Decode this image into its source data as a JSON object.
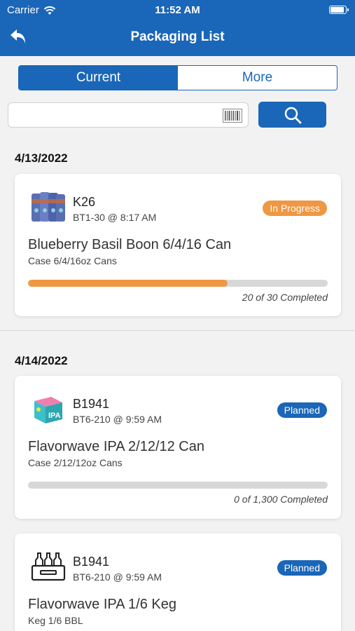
{
  "status_bar": {
    "carrier": "Carrier",
    "time": "11:52 AM"
  },
  "header": {
    "title": "Packaging List"
  },
  "segments": [
    {
      "label": "Current",
      "active": true
    },
    {
      "label": "More",
      "active": false
    }
  ],
  "search": {
    "value": "",
    "placeholder": ""
  },
  "groups": [
    {
      "date": "4/13/2022",
      "cards": [
        {
          "icon": "beer-cans-icon",
          "code": "K26",
          "sub": "BT1-30 @ 8:17 AM",
          "status": "In Progress",
          "status_color": "#ef9742",
          "title": "Blueberry Basil Boon 6/4/16 Can",
          "desc": "Case 6/4/16oz Cans",
          "progress_fraction": 0.6667,
          "progress_text": "20 of 30 Completed"
        }
      ]
    },
    {
      "date": "4/14/2022",
      "cards": [
        {
          "icon": "ipa-box-icon",
          "code": "B1941",
          "sub": "BT6-210 @ 9:59 AM",
          "status": "Planned",
          "status_color": "#1a66b8",
          "title": "Flavorwave IPA 2/12/12 Can",
          "desc": "Case 2/12/12oz Cans",
          "progress_fraction": 0,
          "progress_text": "0 of 1,300 Completed"
        },
        {
          "icon": "bottle-crate-icon",
          "code": "B1941",
          "sub": "BT6-210 @ 9:59 AM",
          "status": "Planned",
          "status_color": "#1a66b8",
          "title": "Flavorwave IPA 1/6 Keg",
          "desc": "Keg 1/6 BBL"
        }
      ]
    }
  ]
}
